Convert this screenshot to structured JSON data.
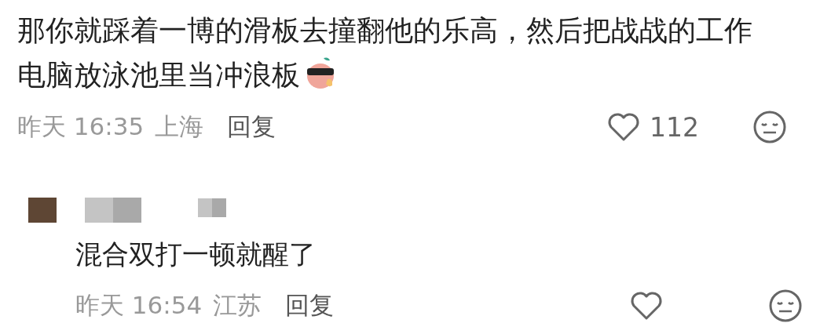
{
  "comment": {
    "text": "那你就踩着一博的滑板去撞翻他的乐高，然后把战战的工作电脑放泳池里当冲浪板",
    "time": "昨天 16:35",
    "location": "上海",
    "reply_label": "回复",
    "like_count": "112"
  },
  "reply": {
    "text": "混合双打一顿就醒了",
    "time": "昨天 16:54",
    "location": "江苏",
    "reply_label": "回复"
  }
}
